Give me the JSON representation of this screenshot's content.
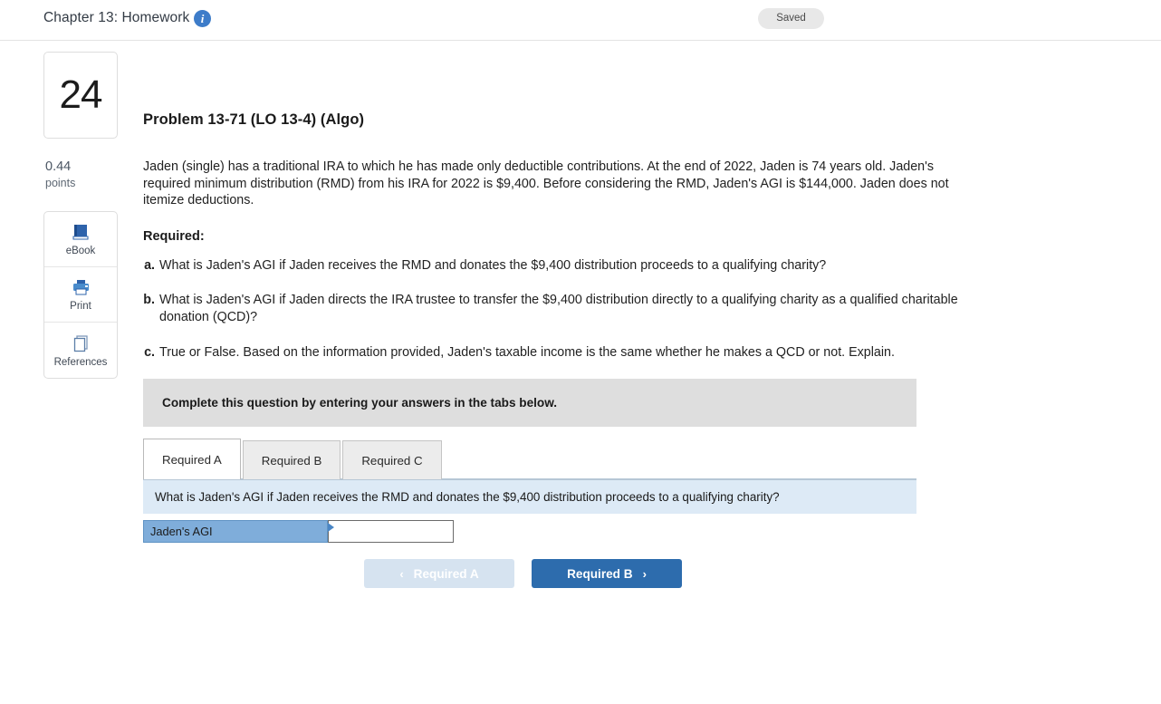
{
  "header": {
    "title": "Chapter 13: Homework",
    "info_icon": "info-icon",
    "status_pill": "Saved"
  },
  "rail": {
    "question_number": "24",
    "points_value": "0.44",
    "points_label": "points",
    "tools": [
      {
        "label": "eBook",
        "icon": "ebook-icon"
      },
      {
        "label": "Print",
        "icon": "printer-icon"
      },
      {
        "label": "References",
        "icon": "references-icon"
      }
    ]
  },
  "problem": {
    "title": "Problem 13-71 (LO 13-4) (Algo)",
    "prompt": "Jaden (single) has a traditional IRA to which he has made only deductible contributions. At the end of 2022, Jaden is 74 years old. Jaden's required minimum distribution (RMD) from his IRA for 2022 is $9,400. Before considering the RMD, Jaden's AGI is $144,000. Jaden does not itemize deductions.",
    "required_heading": "Required:",
    "requirements": [
      {
        "letter": "a.",
        "text": "What is Jaden's AGI if Jaden receives the RMD and donates the $9,400 distribution proceeds to a qualifying charity?"
      },
      {
        "letter": "b.",
        "text": "What is Jaden's AGI if Jaden directs the IRA trustee to transfer the $9,400 distribution directly to a qualifying charity as a qualified charitable donation (QCD)?"
      },
      {
        "letter": "c.",
        "text": "True or False. Based on the information provided, Jaden's taxable income is the same whether he makes a QCD or not. Explain."
      }
    ]
  },
  "panel": {
    "banner": "Complete this question by entering your answers in the tabs below.",
    "tabs": [
      {
        "label": "Required A",
        "active": true
      },
      {
        "label": "Required B",
        "active": false
      },
      {
        "label": "Required C",
        "active": false
      }
    ],
    "question_bar": "What is Jaden's AGI if Jaden receives the RMD and donates the $9,400 distribution proceeds to a qualifying charity?",
    "answer_label": "Jaden's AGI",
    "answer_value": "",
    "answer_placeholder": ""
  },
  "navigation": {
    "prev_label": "Required A",
    "prev_chevron": "‹",
    "next_label": "Required B",
    "next_chevron": "›"
  },
  "colors": {
    "accent_blue": "#2d6cad",
    "label_blue": "#7fadda",
    "question_bar_blue": "#ddeaf6",
    "banner_gray": "#dedede",
    "prev_disabled": "#d6e3f0"
  }
}
